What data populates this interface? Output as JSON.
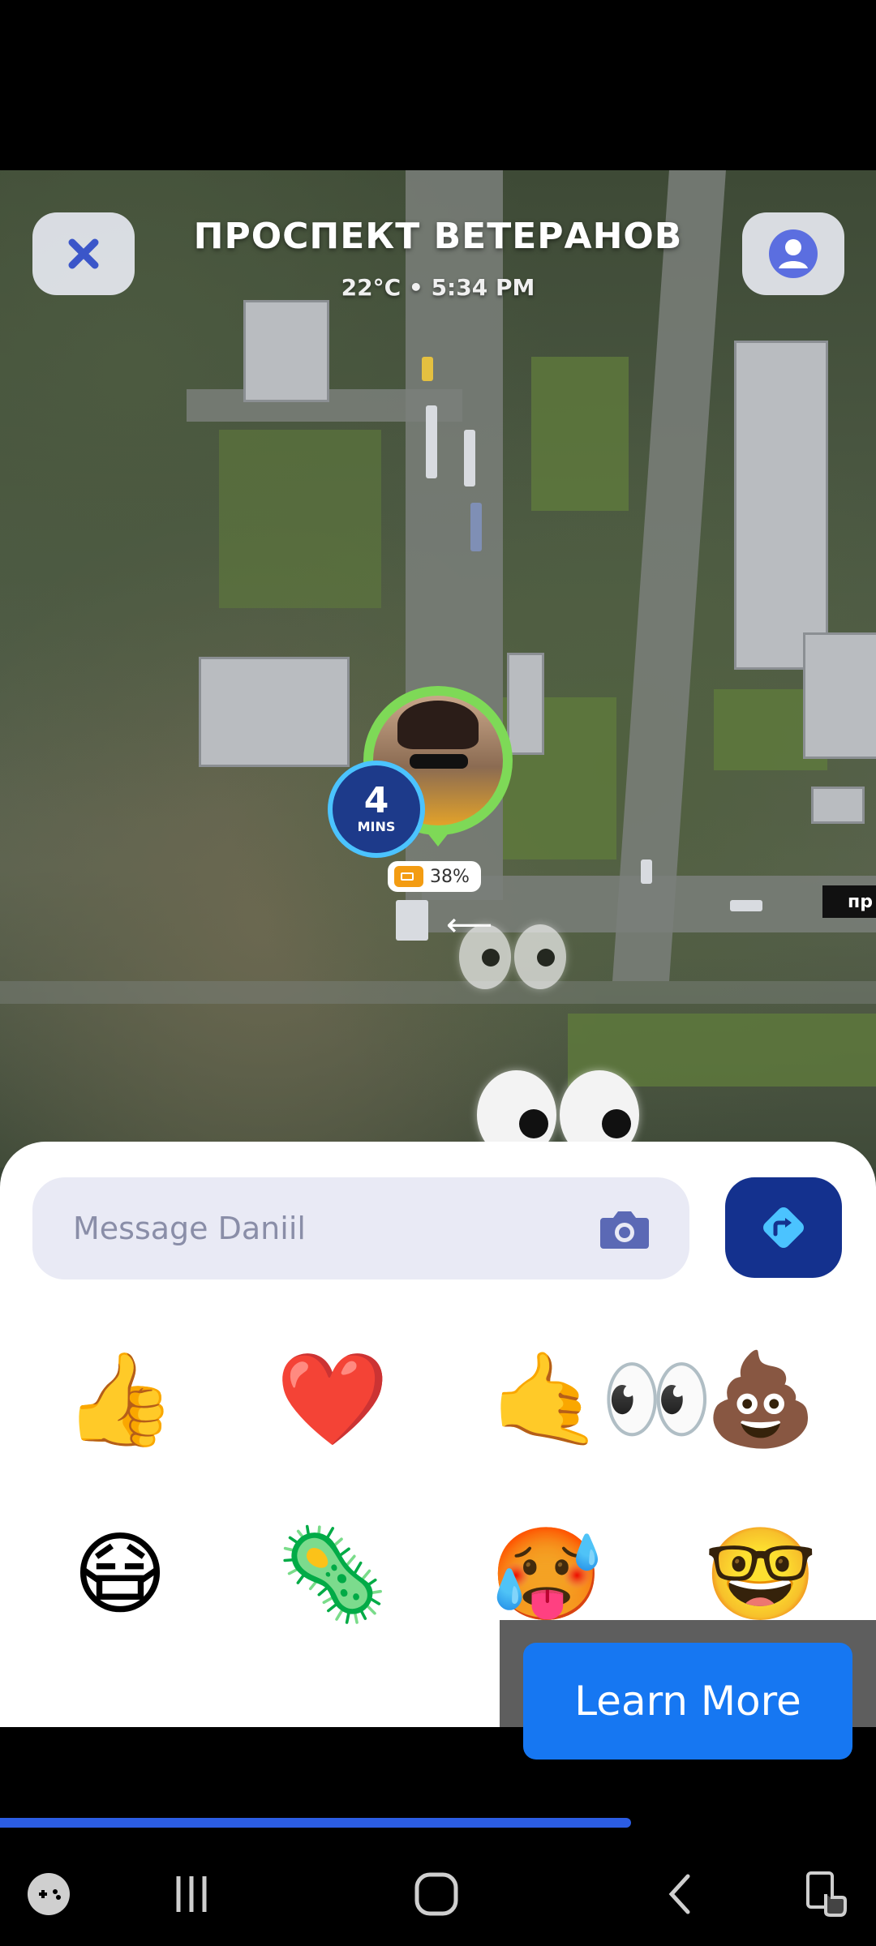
{
  "map": {
    "title": "ПРОСПЕКТ ВЕТЕРАНОВ",
    "subtitle": "22°C • 5:34 PM",
    "eta": {
      "value": "4",
      "unit": "MINS"
    },
    "battery": "38%",
    "street_sign": "пр"
  },
  "composer": {
    "placeholder": "Message Daniil"
  },
  "emojis": [
    "👍",
    "❤️",
    "🤙",
    "👀",
    "💩",
    "😷",
    "🦠",
    "🥵",
    "🤓"
  ],
  "ad": {
    "cta": "Learn More"
  },
  "video_progress": 0.72,
  "icons": {
    "close": "close-icon",
    "profile": "user-icon",
    "camera": "camera-icon",
    "send": "directions-icon",
    "game": "gamepad-icon",
    "recents": "recents-icon",
    "home": "home-icon",
    "back": "back-icon",
    "accessibility": "screen-tap-icon"
  },
  "colors": {
    "accent": "#14318e",
    "pin": "#7ed957",
    "cta": "#1677f2"
  }
}
